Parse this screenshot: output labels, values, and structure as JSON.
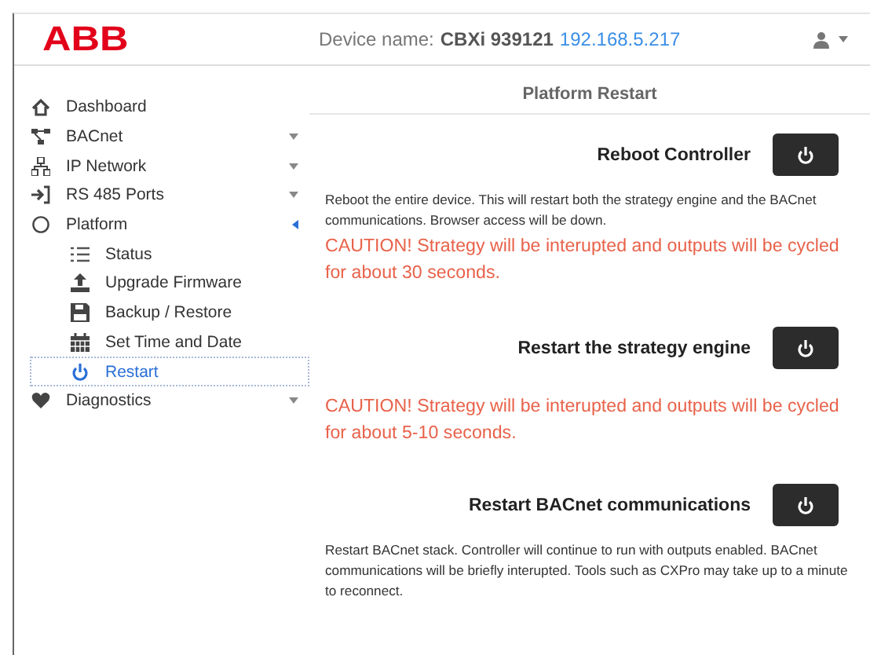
{
  "header": {
    "logo": "ABB",
    "device_label": "Device name:",
    "device_name": "CBXi 939121",
    "ip": "192.168.5.217"
  },
  "sidebar": {
    "items": [
      {
        "label": "Dashboard",
        "selected": false
      },
      {
        "label": "BACnet",
        "selected": false,
        "expanded": false
      },
      {
        "label": "IP Network",
        "selected": false,
        "expanded": false
      },
      {
        "label": "RS 485 Ports",
        "selected": false,
        "expanded": false
      },
      {
        "label": "Platform",
        "selected": false,
        "expanded": true,
        "children": [
          {
            "label": "Status",
            "selected": false
          },
          {
            "label": "Upgrade Firmware",
            "selected": false
          },
          {
            "label": "Backup / Restore",
            "selected": false
          },
          {
            "label": "Set Time and Date",
            "selected": false
          },
          {
            "label": "Restart",
            "selected": true
          }
        ]
      },
      {
        "label": "Diagnostics",
        "selected": false,
        "expanded": false
      }
    ]
  },
  "panel": {
    "title": "Platform Restart",
    "sections": [
      {
        "title": "Reboot Controller",
        "description": "Reboot the entire device. This will restart both the strategy engine and the BACnet communications. Browser access will be down.",
        "caution": "CAUTION! Strategy will be interupted and outputs will be cycled for about 30 seconds."
      },
      {
        "title": "Restart the strategy engine",
        "caution": "CAUTION! Strategy will be interupted and outputs will be cycled for about 5-10 seconds."
      },
      {
        "title": "Restart BACnet communications",
        "description": "Restart BACnet stack. Controller will continue to run with outputs enabled. BACnet communications will be briefly interupted. Tools such as CXPro may take up to a minute to reconnect."
      }
    ]
  }
}
